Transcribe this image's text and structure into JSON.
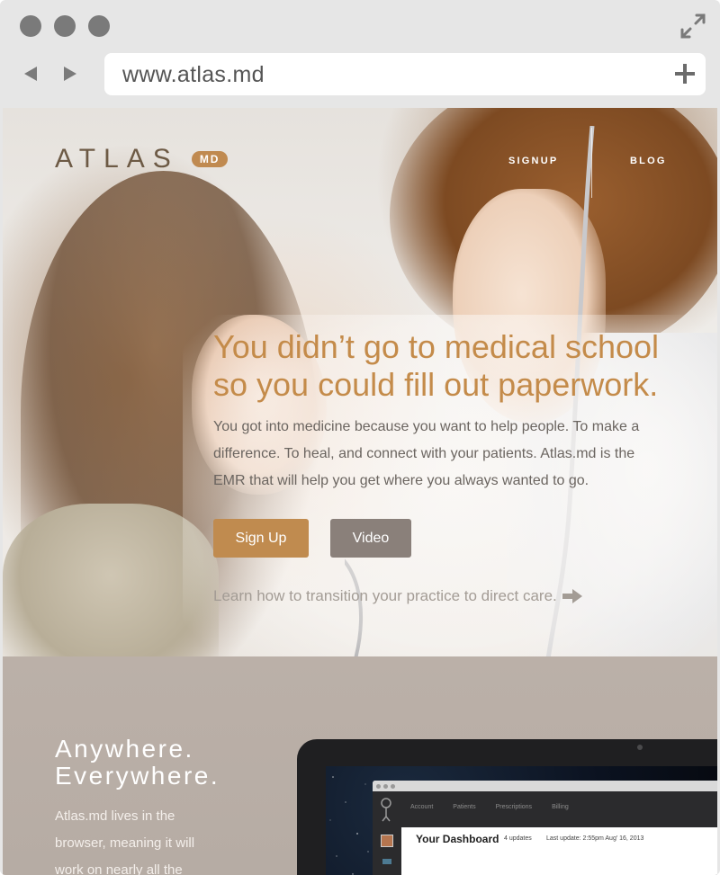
{
  "browser": {
    "url": "www.atlas.md"
  },
  "site": {
    "logo_text": "ATLAS",
    "logo_badge": "MD",
    "nav": [
      {
        "label": "SIGNUP"
      },
      {
        "label": "BLOG"
      }
    ],
    "headline_line1": "You didn’t go to medical school",
    "headline_line2": "so you could fill out paperwork.",
    "subcopy": "You got into medicine because you want to help people. To make a difference. To heal, and connect with your patients. Atlas.md is the EMR that will help you get where you always wanted to go.",
    "signup_button": "Sign Up",
    "video_button": "Video",
    "transition_link": "Learn how to transition your practice to direct care."
  },
  "lower": {
    "title_line1": "Anywhere.",
    "title_line2": "Everywhere.",
    "copy": "Atlas.md lives in the browser, meaning it will work on nearly all the"
  },
  "app_preview": {
    "nav": [
      "Account",
      "Patients",
      "Prescriptions",
      "Billing"
    ],
    "dashboard_title": "Your Dashboard",
    "updates": "4 updates",
    "last_update": "Last update: 2:55pm Aug' 16, 2013"
  },
  "colors": {
    "accent": "#c08b4f",
    "headline": "#c48b4a",
    "video_button": "#8a807a",
    "lower_bg": "#b8ada5"
  }
}
